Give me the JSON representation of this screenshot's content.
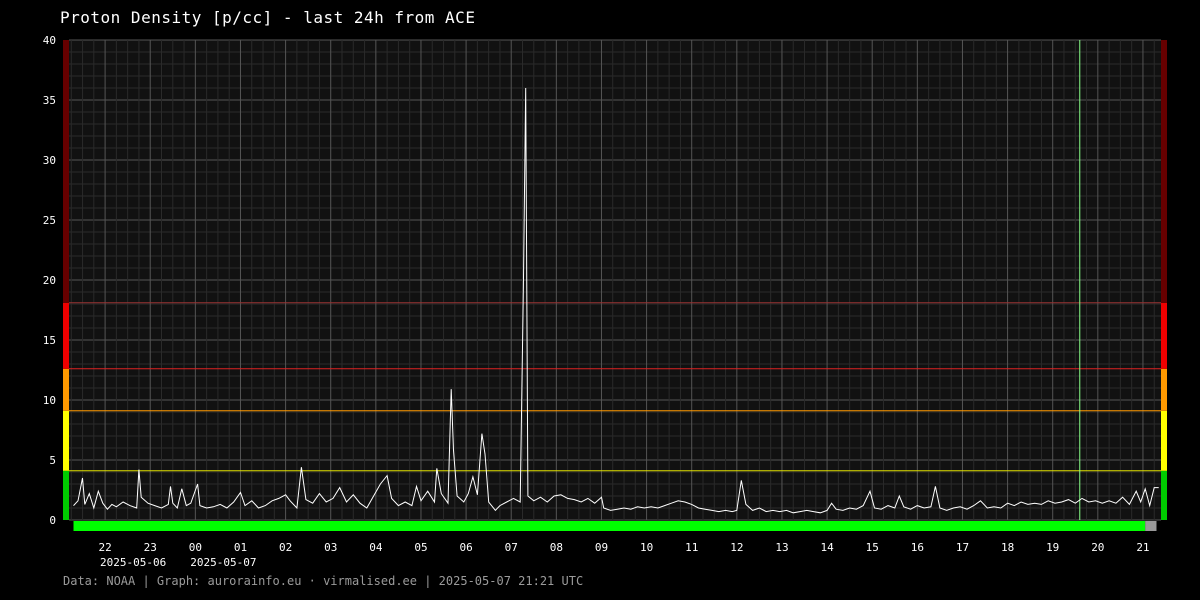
{
  "title": "Proton Density [p/cc] - last 24h from ACE",
  "footer": "Data: NOAA | Graph: aurorainfo.eu · virmalised.ee | 2025-05-07 21:21 UTC",
  "chart_data": {
    "type": "line",
    "title": "Proton Density [p/cc] - last 24h from ACE",
    "xlabel": "",
    "ylabel": "",
    "ylim": [
      0,
      40
    ],
    "xlim_hours": [
      -2.8,
      21.4
    ],
    "y_ticks": [
      "0",
      "5",
      "10",
      "15",
      "20",
      "25",
      "30",
      "35",
      "40"
    ],
    "x_ticks": [
      {
        "label": "22",
        "hour": -2
      },
      {
        "label": "23",
        "hour": -1
      },
      {
        "label": "00",
        "hour": 0
      },
      {
        "label": "01",
        "hour": 1
      },
      {
        "label": "02",
        "hour": 2
      },
      {
        "label": "03",
        "hour": 3
      },
      {
        "label": "04",
        "hour": 4
      },
      {
        "label": "05",
        "hour": 5
      },
      {
        "label": "06",
        "hour": 6
      },
      {
        "label": "07",
        "hour": 7
      },
      {
        "label": "08",
        "hour": 8
      },
      {
        "label": "09",
        "hour": 9
      },
      {
        "label": "10",
        "hour": 10
      },
      {
        "label": "11",
        "hour": 11
      },
      {
        "label": "12",
        "hour": 12
      },
      {
        "label": "13",
        "hour": 13
      },
      {
        "label": "14",
        "hour": 14
      },
      {
        "label": "15",
        "hour": 15
      },
      {
        "label": "16",
        "hour": 16
      },
      {
        "label": "17",
        "hour": 17
      },
      {
        "label": "18",
        "hour": 18
      },
      {
        "label": "19",
        "hour": 19
      },
      {
        "label": "20",
        "hour": 20
      },
      {
        "label": "21",
        "hour": 21
      }
    ],
    "date_labels": [
      {
        "label": "2025-05-06",
        "hour": -2
      },
      {
        "label": "2025-05-07",
        "hour": 0
      }
    ],
    "grid": true,
    "thresholds": [
      {
        "value": 4.1,
        "color": "#e0e000"
      },
      {
        "value": 9.1,
        "color": "#ff9900"
      },
      {
        "value": 12.6,
        "color": "#dd2222"
      },
      {
        "value": 18.1,
        "color": "#993333"
      }
    ],
    "level_bands": [
      {
        "from": 0,
        "to": 4.1,
        "color": "#00cc00"
      },
      {
        "from": 4.1,
        "to": 9.1,
        "color": "#ffff00"
      },
      {
        "from": 9.1,
        "to": 12.6,
        "color": "#ff9900"
      },
      {
        "from": 12.6,
        "to": 18.1,
        "color": "#ee0000"
      },
      {
        "from": 18.1,
        "to": 40,
        "color": "#660000"
      }
    ],
    "current_time_hour": 19.6,
    "series": [
      {
        "color": "#ffffff",
        "points": [
          [
            -2.7,
            1.2
          ],
          [
            -2.6,
            1.6
          ],
          [
            -2.5,
            3.5
          ],
          [
            -2.45,
            1.3
          ],
          [
            -2.35,
            2.2
          ],
          [
            -2.25,
            1.0
          ],
          [
            -2.15,
            2.4
          ],
          [
            -2.05,
            1.4
          ],
          [
            -1.95,
            0.9
          ],
          [
            -1.85,
            1.3
          ],
          [
            -1.75,
            1.1
          ],
          [
            -1.6,
            1.5
          ],
          [
            -1.45,
            1.2
          ],
          [
            -1.3,
            1.0
          ],
          [
            -1.25,
            4.2
          ],
          [
            -1.2,
            1.9
          ],
          [
            -1.05,
            1.4
          ],
          [
            -0.9,
            1.2
          ],
          [
            -0.75,
            1.0
          ],
          [
            -0.6,
            1.3
          ],
          [
            -0.55,
            2.8
          ],
          [
            -0.5,
            1.4
          ],
          [
            -0.4,
            1.0
          ],
          [
            -0.3,
            2.6
          ],
          [
            -0.2,
            1.2
          ],
          [
            -0.1,
            1.4
          ],
          [
            0.05,
            3.0
          ],
          [
            0.1,
            1.2
          ],
          [
            0.25,
            1.0
          ],
          [
            0.4,
            1.1
          ],
          [
            0.55,
            1.3
          ],
          [
            0.7,
            1.0
          ],
          [
            0.85,
            1.5
          ],
          [
            1.0,
            2.3
          ],
          [
            1.1,
            1.2
          ],
          [
            1.25,
            1.6
          ],
          [
            1.4,
            1.0
          ],
          [
            1.55,
            1.2
          ],
          [
            1.7,
            1.6
          ],
          [
            1.85,
            1.8
          ],
          [
            2.0,
            2.1
          ],
          [
            2.1,
            1.6
          ],
          [
            2.25,
            1.0
          ],
          [
            2.35,
            4.4
          ],
          [
            2.45,
            1.7
          ],
          [
            2.6,
            1.4
          ],
          [
            2.75,
            2.2
          ],
          [
            2.9,
            1.5
          ],
          [
            3.05,
            1.8
          ],
          [
            3.2,
            2.7
          ],
          [
            3.35,
            1.5
          ],
          [
            3.5,
            2.1
          ],
          [
            3.65,
            1.4
          ],
          [
            3.8,
            1.0
          ],
          [
            3.95,
            2.0
          ],
          [
            4.1,
            3.0
          ],
          [
            4.25,
            3.7
          ],
          [
            4.35,
            1.8
          ],
          [
            4.5,
            1.2
          ],
          [
            4.65,
            1.5
          ],
          [
            4.8,
            1.2
          ],
          [
            4.9,
            2.8
          ],
          [
            5.0,
            1.6
          ],
          [
            5.15,
            2.4
          ],
          [
            5.3,
            1.5
          ],
          [
            5.35,
            4.3
          ],
          [
            5.45,
            2.2
          ],
          [
            5.6,
            1.4
          ],
          [
            5.67,
            10.9
          ],
          [
            5.72,
            5.8
          ],
          [
            5.8,
            2.0
          ],
          [
            5.95,
            1.5
          ],
          [
            6.05,
            2.2
          ],
          [
            6.15,
            3.6
          ],
          [
            6.25,
            2.1
          ],
          [
            6.35,
            7.2
          ],
          [
            6.42,
            5.5
          ],
          [
            6.5,
            1.5
          ],
          [
            6.65,
            0.8
          ],
          [
            6.75,
            1.2
          ],
          [
            6.9,
            1.5
          ],
          [
            7.05,
            1.8
          ],
          [
            7.2,
            1.5
          ],
          [
            7.27,
            19.5
          ],
          [
            7.32,
            36.0
          ],
          [
            7.37,
            2.0
          ],
          [
            7.5,
            1.6
          ],
          [
            7.65,
            1.9
          ],
          [
            7.8,
            1.5
          ],
          [
            7.95,
            2.0
          ],
          [
            8.1,
            2.1
          ],
          [
            8.25,
            1.8
          ],
          [
            8.4,
            1.7
          ],
          [
            8.55,
            1.5
          ],
          [
            8.7,
            1.8
          ],
          [
            8.85,
            1.4
          ],
          [
            9.0,
            1.9
          ],
          [
            9.05,
            1.0
          ],
          [
            9.2,
            0.8
          ],
          [
            9.35,
            0.9
          ],
          [
            9.5,
            1.0
          ],
          [
            9.65,
            0.9
          ],
          [
            9.8,
            1.1
          ],
          [
            9.95,
            1.0
          ],
          [
            10.1,
            1.1
          ],
          [
            10.25,
            1.0
          ],
          [
            10.4,
            1.2
          ],
          [
            10.55,
            1.4
          ],
          [
            10.7,
            1.6
          ],
          [
            10.85,
            1.5
          ],
          [
            11.0,
            1.3
          ],
          [
            11.15,
            1.0
          ],
          [
            11.3,
            0.9
          ],
          [
            11.45,
            0.8
          ],
          [
            11.6,
            0.7
          ],
          [
            11.75,
            0.8
          ],
          [
            11.9,
            0.7
          ],
          [
            12.0,
            0.8
          ],
          [
            12.1,
            3.3
          ],
          [
            12.2,
            1.3
          ],
          [
            12.35,
            0.8
          ],
          [
            12.5,
            1.0
          ],
          [
            12.65,
            0.7
          ],
          [
            12.8,
            0.8
          ],
          [
            12.95,
            0.7
          ],
          [
            13.1,
            0.8
          ],
          [
            13.25,
            0.6
          ],
          [
            13.4,
            0.7
          ],
          [
            13.55,
            0.8
          ],
          [
            13.7,
            0.7
          ],
          [
            13.85,
            0.6
          ],
          [
            14.0,
            0.8
          ],
          [
            14.1,
            1.4
          ],
          [
            14.2,
            0.9
          ],
          [
            14.35,
            0.8
          ],
          [
            14.5,
            1.0
          ],
          [
            14.65,
            0.9
          ],
          [
            14.8,
            1.2
          ],
          [
            14.95,
            2.4
          ],
          [
            15.05,
            1.0
          ],
          [
            15.2,
            0.9
          ],
          [
            15.35,
            1.2
          ],
          [
            15.5,
            1.0
          ],
          [
            15.6,
            2.0
          ],
          [
            15.7,
            1.1
          ],
          [
            15.85,
            0.9
          ],
          [
            16.0,
            1.2
          ],
          [
            16.15,
            1.0
          ],
          [
            16.3,
            1.1
          ],
          [
            16.4,
            2.8
          ],
          [
            16.5,
            1.0
          ],
          [
            16.65,
            0.8
          ],
          [
            16.8,
            1.0
          ],
          [
            16.95,
            1.1
          ],
          [
            17.1,
            0.9
          ],
          [
            17.25,
            1.2
          ],
          [
            17.4,
            1.6
          ],
          [
            17.55,
            1.0
          ],
          [
            17.7,
            1.1
          ],
          [
            17.85,
            1.0
          ],
          [
            18.0,
            1.4
          ],
          [
            18.15,
            1.2
          ],
          [
            18.3,
            1.5
          ],
          [
            18.45,
            1.3
          ],
          [
            18.6,
            1.4
          ],
          [
            18.75,
            1.3
          ],
          [
            18.9,
            1.6
          ],
          [
            19.05,
            1.4
          ],
          [
            19.2,
            1.5
          ],
          [
            19.35,
            1.7
          ],
          [
            19.5,
            1.4
          ],
          [
            19.65,
            1.8
          ],
          [
            19.8,
            1.5
          ],
          [
            19.95,
            1.6
          ],
          [
            20.1,
            1.4
          ],
          [
            20.25,
            1.6
          ],
          [
            20.4,
            1.4
          ],
          [
            20.55,
            1.9
          ],
          [
            20.7,
            1.3
          ],
          [
            20.85,
            2.4
          ],
          [
            20.95,
            1.5
          ],
          [
            21.05,
            2.6
          ],
          [
            21.15,
            1.2
          ],
          [
            21.25,
            2.7
          ],
          [
            21.35,
            2.7
          ]
        ]
      }
    ],
    "data_quality_bar": [
      {
        "from": -2.7,
        "to": 21.05,
        "color": "#00ff00"
      },
      {
        "from": 21.05,
        "to": 21.3,
        "color": "#999999"
      }
    ]
  }
}
